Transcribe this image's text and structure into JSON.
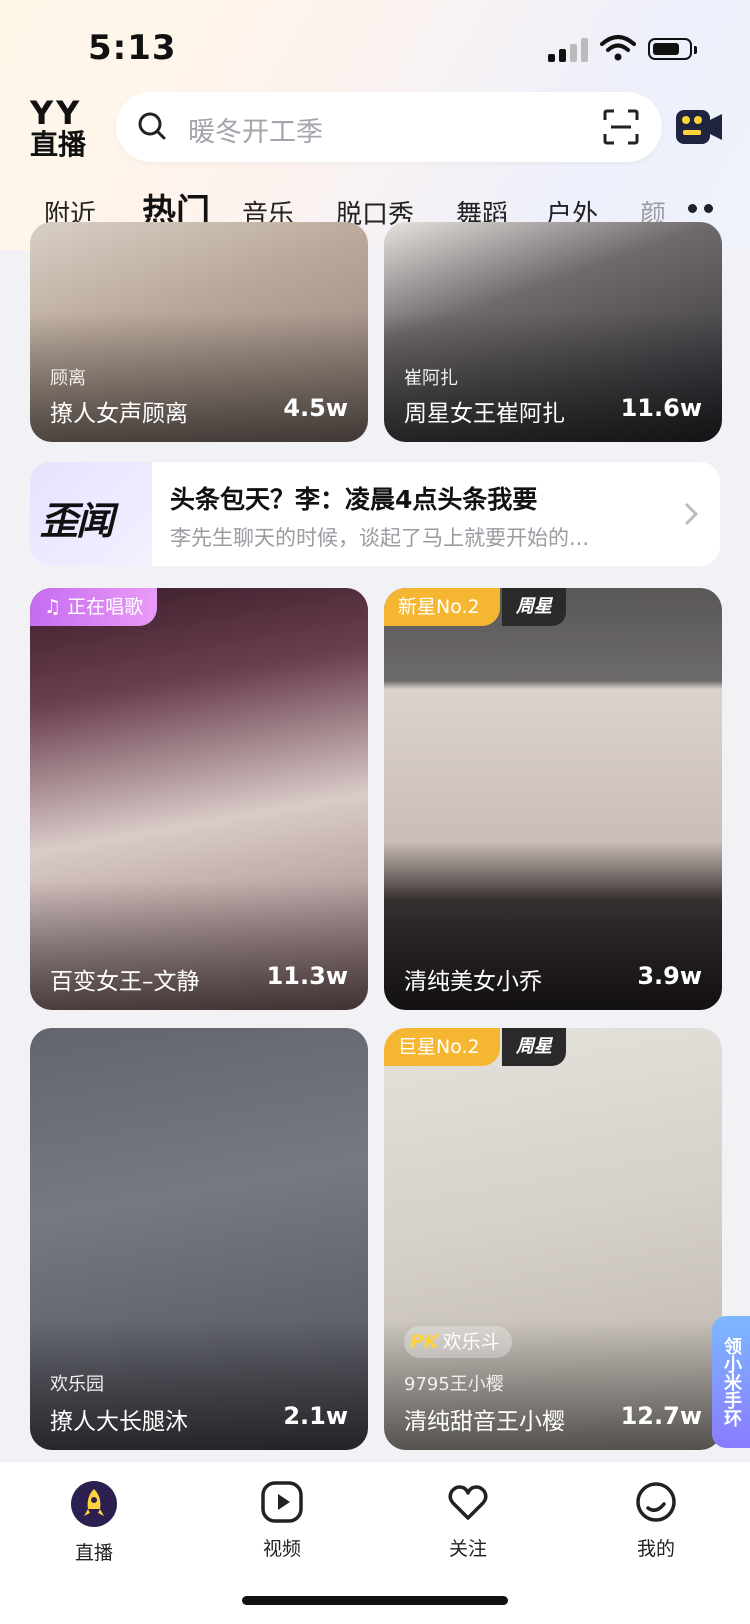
{
  "status_bar": {
    "time": "5:13"
  },
  "header": {
    "logo_top": "YY",
    "logo_bottom": "直播",
    "search_placeholder": "暖冬开工季"
  },
  "tabs": [
    {
      "label": "附近"
    },
    {
      "label": "热门",
      "active": true
    },
    {
      "label": "音乐"
    },
    {
      "label": "脱口秀"
    },
    {
      "label": "舞蹈"
    },
    {
      "label": "户外"
    },
    {
      "label": "颜"
    }
  ],
  "top_cards": [
    {
      "subtitle": "顾离",
      "title": "撩人女声顾离",
      "viewers": "4.5w"
    },
    {
      "subtitle": "崔阿扎",
      "title": "周星女王崔阿扎",
      "viewers": "11.6w"
    }
  ],
  "news": {
    "badge": "歪闻",
    "headline": "头条包天？李：凌晨4点头条我要",
    "desc": "李先生聊天的时候，谈起了马上就要开始的..."
  },
  "cards": [
    {
      "tag": "正在唱歌",
      "title": "百变女王–文静",
      "viewers": "11.3w"
    },
    {
      "tag": "新星No.2",
      "tag2": "周星",
      "title": "清纯美女小乔",
      "viewers": "3.9w"
    },
    {
      "subtitle": "欢乐园",
      "title": "撩人大长腿沐",
      "viewers": "2.1w"
    },
    {
      "tag": "巨星No.2",
      "tag2": "周星",
      "pk_label": "欢乐斗",
      "subtitle": "9795王小樱",
      "title": "清纯甜音王小樱",
      "viewers": "12.7w"
    }
  ],
  "side_badge": "领小米手环",
  "bottom_nav": [
    {
      "label": "直播",
      "icon": "live-rocket-icon",
      "active": true
    },
    {
      "label": "视频",
      "icon": "play-icon"
    },
    {
      "label": "关注",
      "icon": "heart-icon"
    },
    {
      "label": "我的",
      "icon": "profile-icon"
    }
  ],
  "colors": {
    "accent": "#f5b731",
    "sing_tag": "#c56cf0",
    "nav_active": "#2b2050"
  }
}
